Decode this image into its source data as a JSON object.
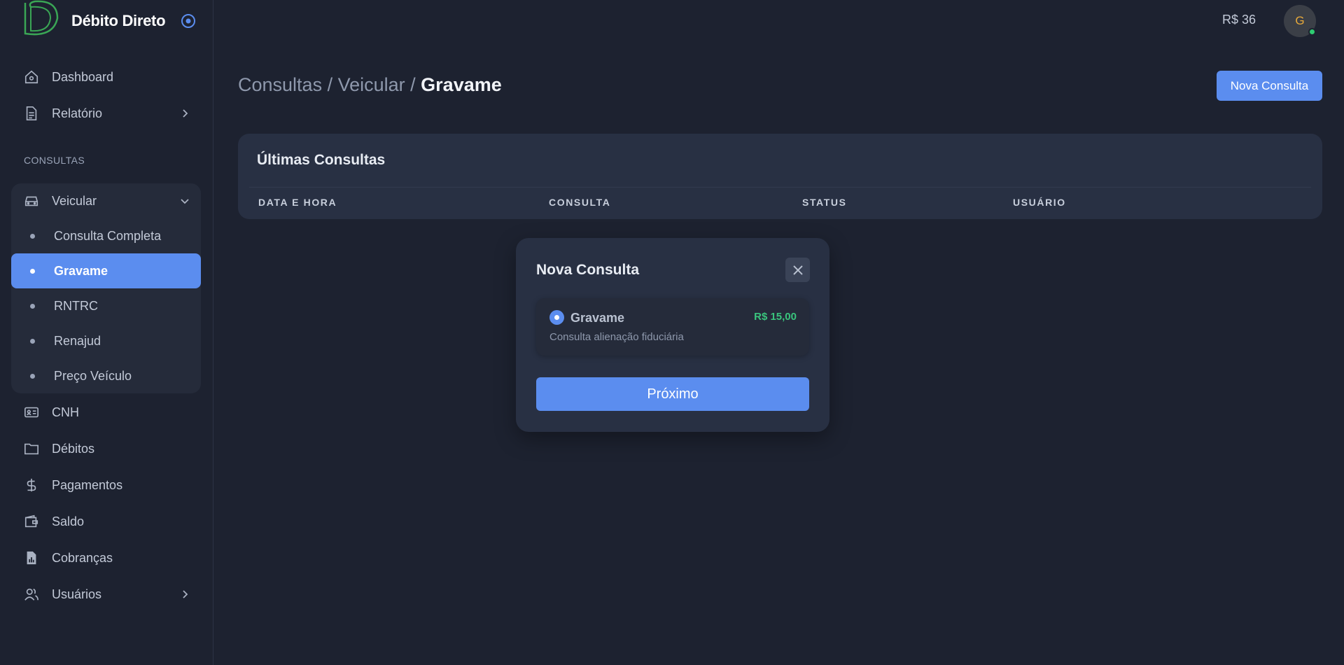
{
  "app": {
    "name": "Débito Direto"
  },
  "sidebar": {
    "items": [
      {
        "label": "Dashboard",
        "icon": "home-icon"
      },
      {
        "label": "Relatório",
        "icon": "document-icon"
      }
    ],
    "section_label": "CONSULTAS",
    "veicular": {
      "label": "Veicular",
      "icon": "car-icon",
      "sub_items": [
        {
          "label": "Consulta Completa",
          "active": false
        },
        {
          "label": "Gravame",
          "active": true
        },
        {
          "label": "RNTRC",
          "active": false
        },
        {
          "label": "Renajud",
          "active": false
        },
        {
          "label": "Preço Veículo",
          "active": false
        }
      ]
    },
    "items_after": [
      {
        "label": "CNH",
        "icon": "id-card-icon"
      },
      {
        "label": "Débitos",
        "icon": "folder-icon"
      },
      {
        "label": "Pagamentos",
        "icon": "dollar-icon"
      },
      {
        "label": "Saldo",
        "icon": "wallet-icon"
      },
      {
        "label": "Cobranças",
        "icon": "invoice-icon"
      },
      {
        "label": "Usuários",
        "icon": "users-icon"
      }
    ]
  },
  "header": {
    "balance": "R$ 36",
    "avatar_initial": "G"
  },
  "page": {
    "breadcrumb": {
      "part1": "Consultas",
      "sep1": " / ",
      "part2": "Veicular",
      "sep2": " / ",
      "current": "Gravame"
    },
    "new_button": "Nova Consulta"
  },
  "card": {
    "title": "Últimas Consultas",
    "columns": [
      "DATA E HORA",
      "CONSULTA",
      "STATUS",
      "USUÁRIO"
    ]
  },
  "modal": {
    "title": "Nova Consulta",
    "option": {
      "name": "Gravame",
      "price": "R$ 15,00",
      "description": "Consulta alienação fiduciária"
    },
    "next_button": "Próximo"
  },
  "colors": {
    "accent": "#5b8def",
    "price": "#3ac47d",
    "background": "#1d2230",
    "card": "#283043",
    "online": "#2ecc71"
  }
}
